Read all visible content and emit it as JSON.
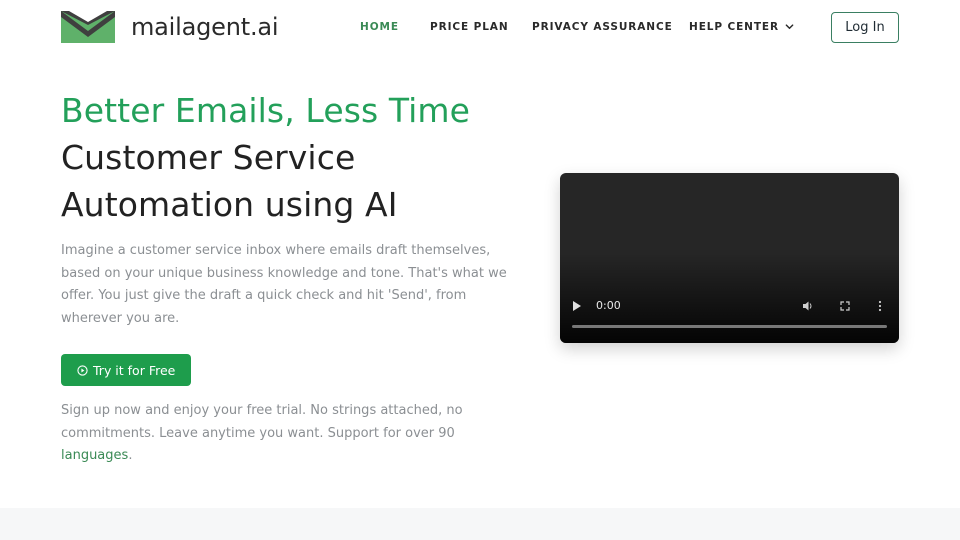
{
  "brand": {
    "name": "mailagent",
    "tld": ".ai",
    "colors": {
      "green": "#23a05a",
      "dark_green": "#3d4f3f",
      "text": "#2b2b2b"
    }
  },
  "nav": {
    "items": [
      {
        "label": "HOME",
        "active": true
      },
      {
        "label": "PRICE PLAN",
        "active": false
      },
      {
        "label": "PRIVACY ASSURANCE",
        "active": false
      },
      {
        "label": "HELP CENTER",
        "active": false,
        "has_dropdown": true
      }
    ],
    "login_label": "Log In"
  },
  "hero": {
    "title_highlight": "Better Emails, Less Time",
    "title_line2": "Customer Service",
    "title_line3": "Automation using AI",
    "description": "Imagine a customer service inbox where emails draft themselves, based on your unique business knowledge and tone. That's what we offer. You just give the draft a quick check and hit 'Send', from wherever you are.",
    "cta_label": "Try it for Free",
    "note_text": "Sign up now and enjoy your free trial. No strings attached, no commitments. Leave anytime you want. Support for over 90 ",
    "note_link": "languages",
    "note_end": "."
  },
  "video": {
    "time": "0:00",
    "progress": 0
  }
}
